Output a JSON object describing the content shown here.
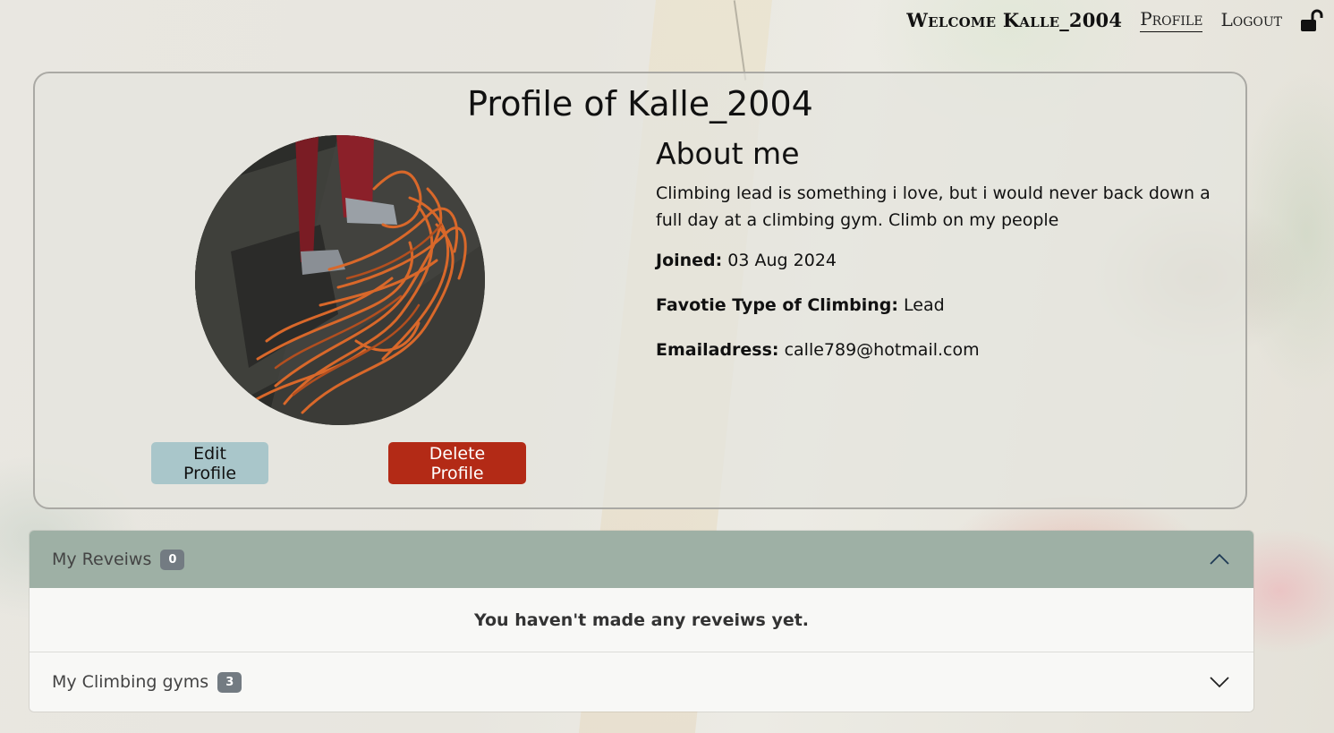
{
  "nav": {
    "welcome": "Welcome Kalle_2004",
    "profile_link": "Profile",
    "logout_link": "Logout",
    "lock_icon": "unlocked-padlock-icon"
  },
  "profile": {
    "title": "Profile of Kalle_2004",
    "about_heading": "About me",
    "bio": "Climbing lead is something i love, but i would never back down a full day at a climbing gym. Climb on my people",
    "joined_label": "Joined:",
    "joined_value": "03 Aug 2024",
    "favorite_label": "Favotie Type of Climbing:",
    "favorite_value": "Lead",
    "email_label": "Emailadress:",
    "email_value": "calle789@hotmail.com",
    "edit_button": "Edit Profile",
    "delete_button": "Delete Profile"
  },
  "accordion": {
    "reviews": {
      "label": "My Reveiws",
      "count": "0",
      "empty_message": "You haven't made any reveiws yet.",
      "expanded": true
    },
    "gyms": {
      "label": "My Climbing gyms",
      "count": "3",
      "expanded": false
    }
  },
  "colors": {
    "delete": "#b32a16",
    "edit": "#a9c6ca",
    "accordion_open": "#9eb0a5",
    "badge": "#737b82"
  }
}
